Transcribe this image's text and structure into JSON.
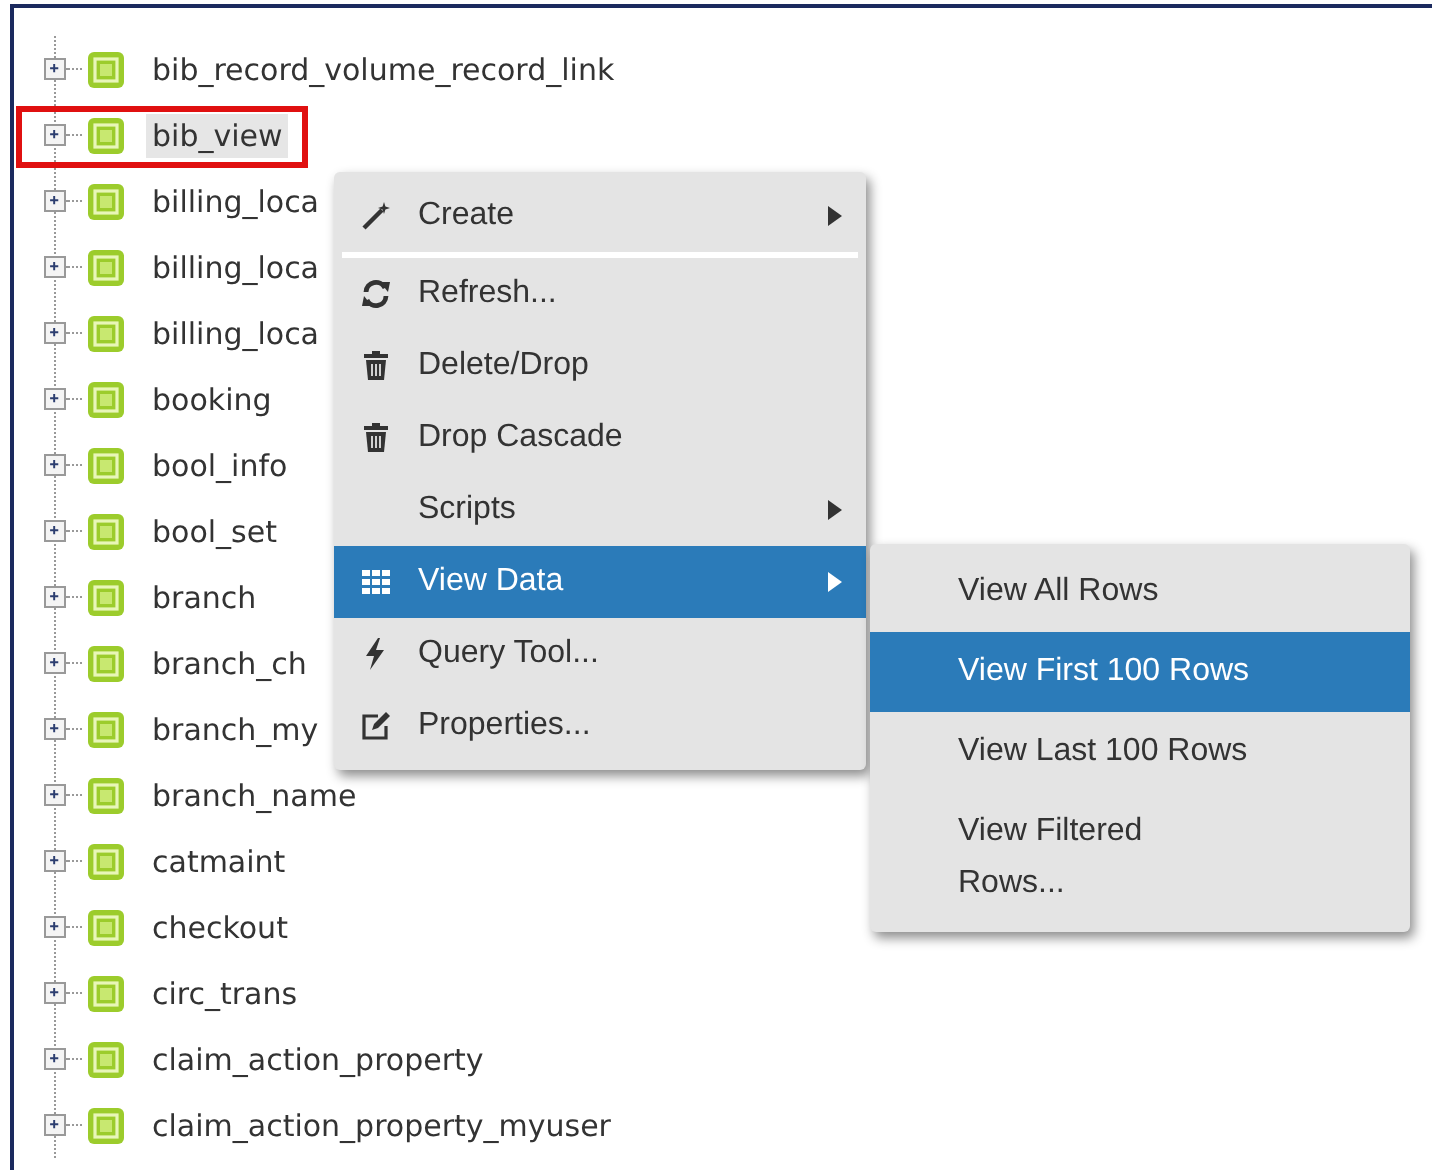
{
  "tree": {
    "items": [
      {
        "label": "bib_record_volume_record_link",
        "selected": false,
        "highlighted": false
      },
      {
        "label": "bib_view",
        "selected": true,
        "highlighted": true
      },
      {
        "label": "billing_loca",
        "selected": false,
        "highlighted": false
      },
      {
        "label": "billing_loca",
        "selected": false,
        "highlighted": false
      },
      {
        "label": "billing_loca",
        "selected": false,
        "highlighted": false
      },
      {
        "label": "booking",
        "selected": false,
        "highlighted": false
      },
      {
        "label": "bool_info",
        "selected": false,
        "highlighted": false
      },
      {
        "label": "bool_set",
        "selected": false,
        "highlighted": false
      },
      {
        "label": "branch",
        "selected": false,
        "highlighted": false
      },
      {
        "label": "branch_ch",
        "selected": false,
        "highlighted": false
      },
      {
        "label": "branch_my",
        "selected": false,
        "highlighted": false
      },
      {
        "label": "branch_name",
        "selected": false,
        "highlighted": false
      },
      {
        "label": "catmaint",
        "selected": false,
        "highlighted": false
      },
      {
        "label": "checkout",
        "selected": false,
        "highlighted": false
      },
      {
        "label": "circ_trans",
        "selected": false,
        "highlighted": false
      },
      {
        "label": "claim_action_property",
        "selected": false,
        "highlighted": false
      },
      {
        "label": "claim_action_property_myuser",
        "selected": false,
        "highlighted": false
      }
    ]
  },
  "context_menu": {
    "items": [
      {
        "kind": "item",
        "label": "Create",
        "submenu": true,
        "selected": false
      },
      {
        "kind": "separator"
      },
      {
        "kind": "item",
        "label": "Refresh...",
        "submenu": false,
        "selected": false
      },
      {
        "kind": "item",
        "label": "Delete/Drop",
        "submenu": false,
        "selected": false
      },
      {
        "kind": "item",
        "label": "Drop Cascade",
        "submenu": false,
        "selected": false
      },
      {
        "kind": "item",
        "label": "Scripts",
        "submenu": true,
        "selected": false
      },
      {
        "kind": "item",
        "label": "View Data",
        "submenu": true,
        "selected": true
      },
      {
        "kind": "item",
        "label": "Query Tool...",
        "submenu": false,
        "selected": false
      },
      {
        "kind": "item",
        "label": "Properties...",
        "submenu": false,
        "selected": false
      }
    ]
  },
  "submenu": {
    "items": [
      {
        "label": "View All Rows",
        "selected": false
      },
      {
        "label": "View First 100 Rows",
        "selected": true
      },
      {
        "label": "View Last 100 Rows",
        "selected": false
      },
      {
        "label": "View Filtered Rows...",
        "selected": false
      }
    ]
  }
}
